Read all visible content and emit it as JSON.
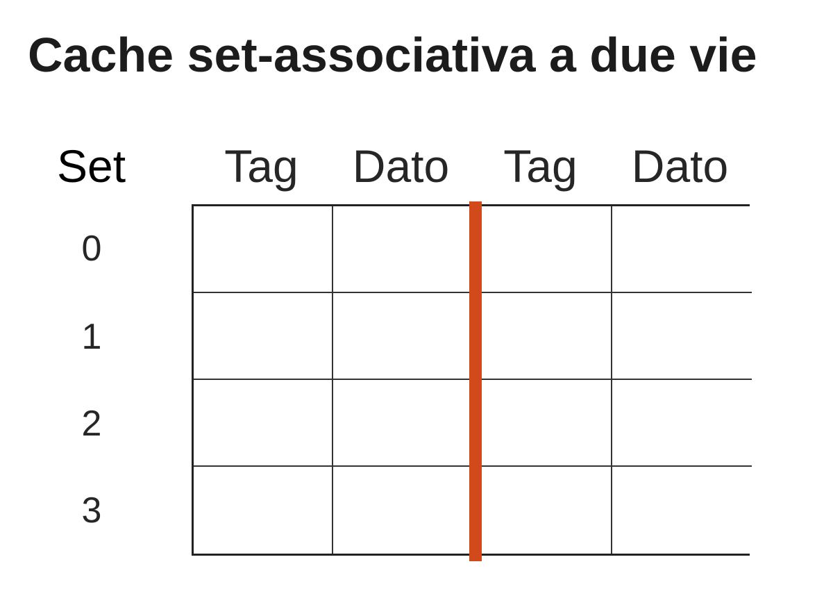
{
  "title": "Cache set-associativa a due vie",
  "set_header": "Set",
  "column_headers": [
    "Tag",
    "Dato",
    "Tag",
    "Dato"
  ],
  "sets": [
    "0",
    "1",
    "2",
    "3"
  ],
  "colors": {
    "way_divider": "#d24a1c",
    "grid_lines": "#222222",
    "text": "#1a1a1a"
  }
}
